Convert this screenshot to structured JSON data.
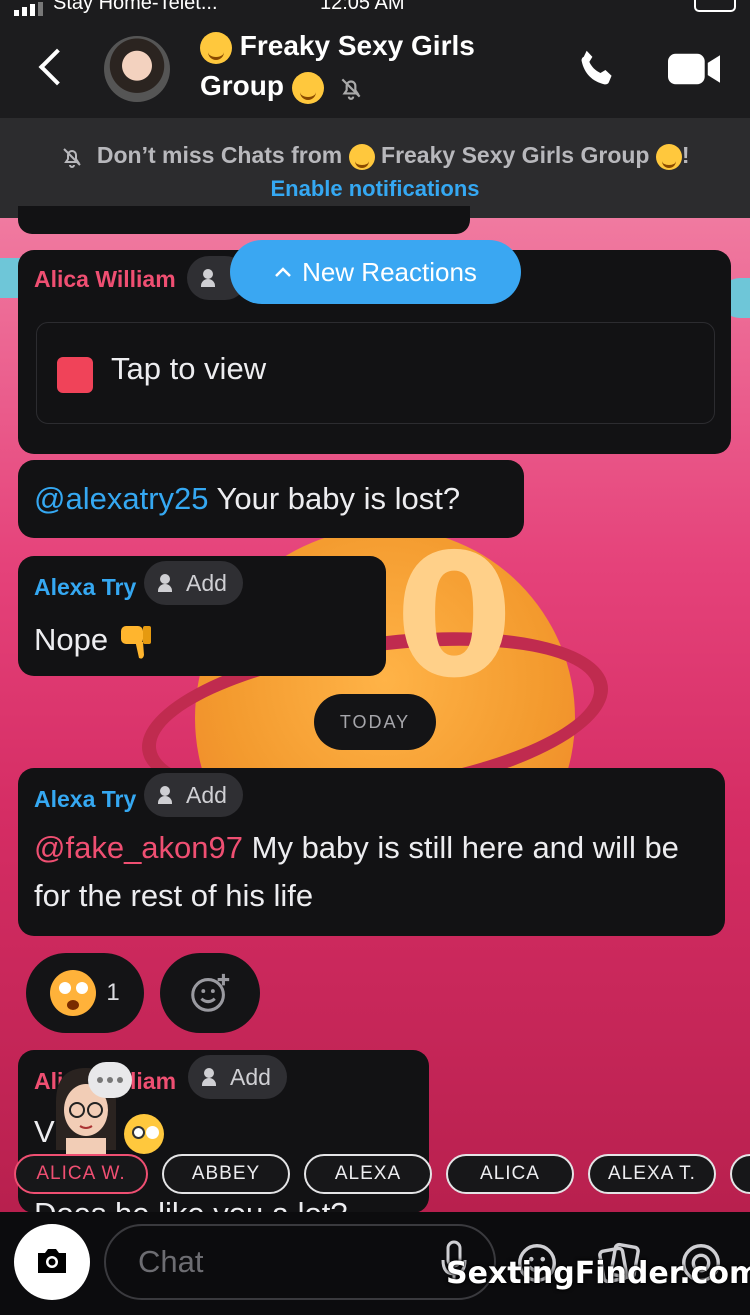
{
  "status_bar": {
    "carrier": "Stay Home-Telet...",
    "time": "12:05 AM"
  },
  "header": {
    "title_line1": "Freaky Sexy Girls",
    "title_line2": "Group"
  },
  "banner": {
    "text_part1": "Don’t miss Chats from",
    "group_name": "Freaky Sexy Girls Group",
    "text_end": "!",
    "enable_label": "Enable notifications"
  },
  "new_reactions_label": "New Reactions",
  "messages": [
    {
      "sender": "Alica William",
      "add_label": "Add",
      "snap_label": "Tap to view"
    },
    {
      "mention": "@alexatry25",
      "text": " Your baby is lost?"
    },
    {
      "sender": "Alexa Try",
      "add_label": "Add",
      "text": "Nope"
    },
    {
      "sender": "Alexa Try",
      "add_label": "Add",
      "mention": "@fake_akon97",
      "text": " My baby is still here and will be for the rest of his life"
    },
    {
      "sender_partial_left": "Ali",
      "sender_partial_right": "liam",
      "add_label": "Add",
      "text_partial": "V",
      "text_cut": "Does he like you a lot?"
    }
  ],
  "today_label": "TODAY",
  "reaction": {
    "count": "1",
    "icon": "shocked-face-emoji"
  },
  "mention_chips": [
    "ALICA W.",
    "ABBEY",
    "ALEXA",
    "ALICA",
    "ALEXA T.",
    ""
  ],
  "bottom_bar": {
    "chat_placeholder": "Chat"
  },
  "watermark": "SextingFinder.com",
  "colors": {
    "accent_blue": "#35a8f2",
    "accent_pink": "#ef4f72",
    "snap_red": "#f04359"
  }
}
